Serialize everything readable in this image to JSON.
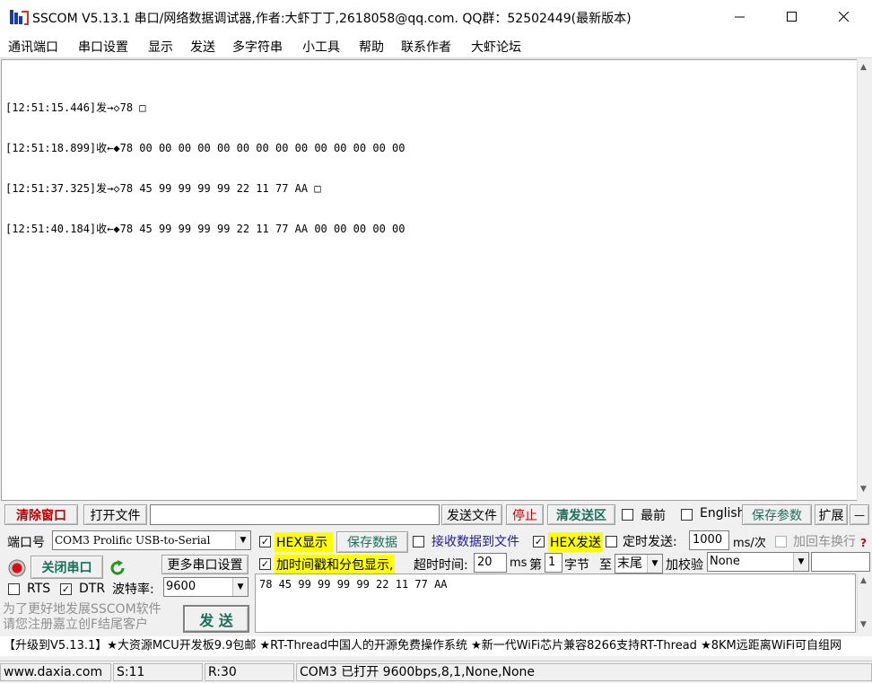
{
  "window": {
    "title": "SSCOM V5.13.1 串口/网络数据调试器,作者:大虾丁丁,2618058@qq.com. QQ群：52502449(最新版本)"
  },
  "menu": [
    "通讯端口",
    "串口设置",
    "显示",
    "发送",
    "多字符串",
    "小工具",
    "帮助",
    "联系作者",
    "大虾论坛"
  ],
  "output": {
    "lines": [
      "[12:51:15.446]发→◇78 □",
      "[12:51:18.899]收←◆78 00 00 00 00 00 00 00 00 00 00 00 00 00 00",
      "[12:51:37.325]发→◇78 45 99 99 99 99 22 11 77 AA □",
      "[12:51:40.184]收←◆78 45 99 99 99 99 22 11 77 AA 00 00 00 00 00"
    ]
  },
  "toolbar": {
    "clear_window": "清除窗口",
    "open_file": "打开文件",
    "file_path": "",
    "send_file": "发送文件",
    "stop": "停止",
    "clear_send": "清发送区",
    "topmost": "最前",
    "english": "English",
    "save_params": "保存参数",
    "expand": "扩展",
    "collapse": "—"
  },
  "port": {
    "label": "端口号",
    "value": "COM3 Prolific USB-to-Serial",
    "close_port": "关闭串口",
    "more_settings": "更多串口设置",
    "rts": "RTS",
    "dtr": "DTR",
    "baud_label": "波特率:",
    "baud_value": "9600"
  },
  "options": {
    "hex_display": "HEX显示",
    "save_data": "保存数据",
    "receive_to_file": "接收数据到文件",
    "hex_send": "HEX发送",
    "timed_send": "定时发送:",
    "interval": "1000",
    "interval_unit": "ms/次",
    "add_newline": "加回车换行",
    "timestamp": "加时间戳和分包显示,",
    "timeout_label": "超时时间:",
    "timeout_value": "20",
    "timeout_unit": "ms",
    "byte_prefix": "第",
    "byte_index": "1",
    "byte_unit": "字节",
    "to_label": "至",
    "to_value": "末尾",
    "checksum_label": "加校验",
    "checksum_value": "None"
  },
  "send": {
    "content": "78 45 99 99 99 99 22 11 77 AA",
    "button": "发 送"
  },
  "promo": {
    "line1": "为了更好地发展SSCOM软件",
    "line2": "请您注册嘉立创F结尾客户",
    "marquee": "【升级到V5.13.1】★大资源MCU开发板9.9包邮 ★RT-Thread中国人的开源免费操作系统 ★新一代WiFi芯片兼容8266支持RT-Thread ★8KM远距离WiFi可自组网"
  },
  "status": {
    "website": "www.daxia.com",
    "sent": "S:11",
    "received": "R:30",
    "port_status": "COM3 已打开  9600bps,8,1,None,None"
  },
  "colors": {
    "highlight_yellow": "#ffff00",
    "accent_red": "#c00000",
    "accent_teal": "#1a6f5a"
  }
}
